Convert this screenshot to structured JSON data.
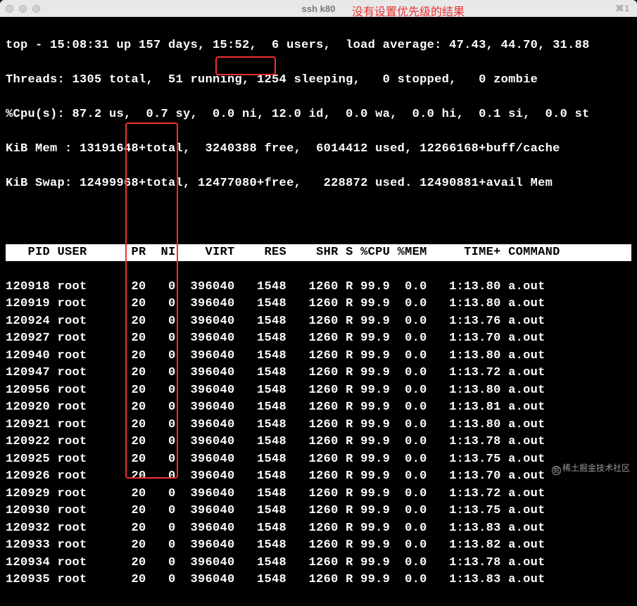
{
  "window": {
    "title": "ssh k80",
    "shortcut": "⌘1"
  },
  "annotation": "没有设置优先级的结果",
  "summary": {
    "l1": "top - 15:08:31 up 157 days, 15:52,  6 users,  load average: 47.43, 44.70, 31.88",
    "l2": "Threads: 1305 total,  51 running, 1254 sleeping,   0 stopped,   0 zombie",
    "l3": "%Cpu(s): 87.2 us,  0.7 sy,  0.0 ni, 12.0 id,  0.0 wa,  0.0 hi,  0.1 si,  0.0 st",
    "l4": "KiB Mem : 13191648+total,  3240388 free,  6014412 used, 12266168+buff/cache",
    "l5": "KiB Swap: 12499968+total, 12477080+free,   228872 used. 12490881+avail Mem"
  },
  "columns": "   PID USER      PR  NI    VIRT    RES    SHR S %CPU %MEM     TIME+ COMMAND          ",
  "processes": [
    {
      "row": "120918 root      20   0  396040   1548   1260 R 99.9  0.0   1:13.80 a.out"
    },
    {
      "row": "120919 root      20   0  396040   1548   1260 R 99.9  0.0   1:13.80 a.out"
    },
    {
      "row": "120924 root      20   0  396040   1548   1260 R 99.9  0.0   1:13.76 a.out"
    },
    {
      "row": "120927 root      20   0  396040   1548   1260 R 99.9  0.0   1:13.70 a.out"
    },
    {
      "row": "120940 root      20   0  396040   1548   1260 R 99.9  0.0   1:13.80 a.out"
    },
    {
      "row": "120947 root      20   0  396040   1548   1260 R 99.9  0.0   1:13.72 a.out"
    },
    {
      "row": "120956 root      20   0  396040   1548   1260 R 99.9  0.0   1:13.80 a.out"
    },
    {
      "row": "120920 root      20   0  396040   1548   1260 R 99.9  0.0   1:13.81 a.out"
    },
    {
      "row": "120921 root      20   0  396040   1548   1260 R 99.9  0.0   1:13.80 a.out"
    },
    {
      "row": "120922 root      20   0  396040   1548   1260 R 99.9  0.0   1:13.78 a.out"
    },
    {
      "row": "120925 root      20   0  396040   1548   1260 R 99.9  0.0   1:13.75 a.out"
    },
    {
      "row": "120926 root      20   0  396040   1548   1260 R 99.9  0.0   1:13.70 a.out"
    },
    {
      "row": "120929 root      20   0  396040   1548   1260 R 99.9  0.0   1:13.72 a.out"
    },
    {
      "row": "120930 root      20   0  396040   1548   1260 R 99.9  0.0   1:13.75 a.out"
    },
    {
      "row": "120932 root      20   0  396040   1548   1260 R 99.9  0.0   1:13.83 a.out"
    },
    {
      "row": "120933 root      20   0  396040   1548   1260 R 99.9  0.0   1:13.82 a.out"
    },
    {
      "row": "120934 root      20   0  396040   1548   1260 R 99.9  0.0   1:13.78 a.out"
    },
    {
      "row": "120935 root      20   0  396040   1548   1260 R 99.9  0.0   1:13.83 a.out"
    }
  ],
  "watermark": "稀土掘金技术社区"
}
